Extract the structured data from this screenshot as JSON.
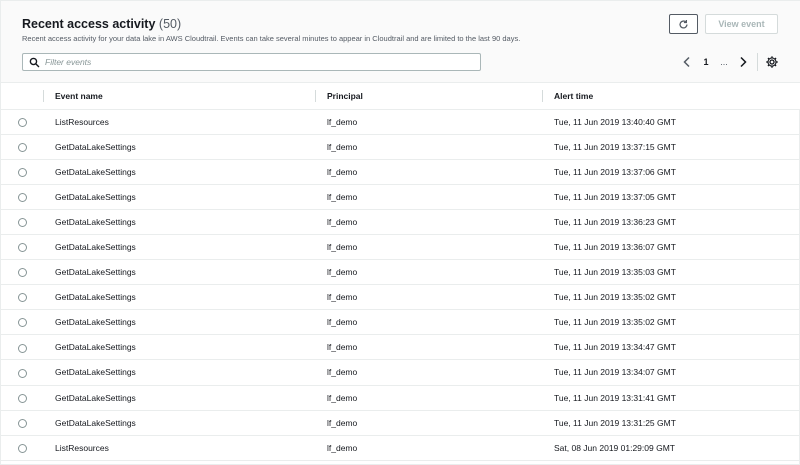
{
  "header": {
    "title": "Recent access activity",
    "count": "(50)",
    "subtitle": "Recent access activity for your data lake in AWS Cloudtrail. Events can take several minutes to appear in Cloudtrail and are limited to the last 90 days.",
    "refresh_icon": "refresh-icon",
    "view_event_label": "View event"
  },
  "filter": {
    "placeholder": "Filter events",
    "value": "",
    "icon": "search-icon"
  },
  "pagination": {
    "current_page": "1",
    "ellipsis": "...",
    "prev_icon": "chevron-left-icon",
    "next_icon": "chevron-right-icon",
    "settings_icon": "gear-icon"
  },
  "colors": {
    "border": "#eaeded",
    "header_bg": "#fafafa",
    "text": "#16191f",
    "muted": "#545b64"
  },
  "table": {
    "columns": [
      "Event name",
      "Principal",
      "Alert time"
    ],
    "rows": [
      {
        "event": "ListResources",
        "principal": "lf_demo",
        "time": "Tue, 11 Jun 2019 13:40:40 GMT"
      },
      {
        "event": "GetDataLakeSettings",
        "principal": "lf_demo",
        "time": "Tue, 11 Jun 2019 13:37:15 GMT"
      },
      {
        "event": "GetDataLakeSettings",
        "principal": "lf_demo",
        "time": "Tue, 11 Jun 2019 13:37:06 GMT"
      },
      {
        "event": "GetDataLakeSettings",
        "principal": "lf_demo",
        "time": "Tue, 11 Jun 2019 13:37:05 GMT"
      },
      {
        "event": "GetDataLakeSettings",
        "principal": "lf_demo",
        "time": "Tue, 11 Jun 2019 13:36:23 GMT"
      },
      {
        "event": "GetDataLakeSettings",
        "principal": "lf_demo",
        "time": "Tue, 11 Jun 2019 13:36:07 GMT"
      },
      {
        "event": "GetDataLakeSettings",
        "principal": "lf_demo",
        "time": "Tue, 11 Jun 2019 13:35:03 GMT"
      },
      {
        "event": "GetDataLakeSettings",
        "principal": "lf_demo",
        "time": "Tue, 11 Jun 2019 13:35:02 GMT"
      },
      {
        "event": "GetDataLakeSettings",
        "principal": "lf_demo",
        "time": "Tue, 11 Jun 2019 13:35:02 GMT"
      },
      {
        "event": "GetDataLakeSettings",
        "principal": "lf_demo",
        "time": "Tue, 11 Jun 2019 13:34:47 GMT"
      },
      {
        "event": "GetDataLakeSettings",
        "principal": "lf_demo",
        "time": "Tue, 11 Jun 2019 13:34:07 GMT"
      },
      {
        "event": "GetDataLakeSettings",
        "principal": "lf_demo",
        "time": "Tue, 11 Jun 2019 13:31:41 GMT"
      },
      {
        "event": "GetDataLakeSettings",
        "principal": "lf_demo",
        "time": "Tue, 11 Jun 2019 13:31:25 GMT"
      },
      {
        "event": "ListResources",
        "principal": "lf_demo",
        "time": "Sat, 08 Jun 2019 01:29:09 GMT"
      }
    ]
  }
}
